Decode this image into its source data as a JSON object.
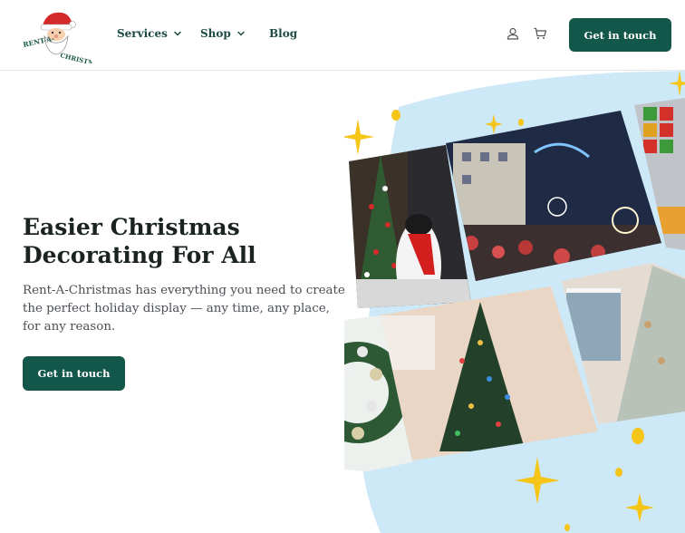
{
  "header": {
    "logo_text": "RENT-A-CHRISTMAS",
    "nav": [
      {
        "label": "Services",
        "has_dropdown": true
      },
      {
        "label": "Shop",
        "has_dropdown": true
      },
      {
        "label": "Blog",
        "has_dropdown": false
      }
    ],
    "icons": [
      "user-icon",
      "cart-icon"
    ],
    "cta_label": "Get in touch"
  },
  "hero": {
    "title": "Easier Christmas Decorating For All",
    "subtitle": "Rent-A-Christmas has everything you need to create the perfect holiday display — any time, any place, for any reason.",
    "cta_label": "Get in touch"
  },
  "colors": {
    "brand_green": "#12574a",
    "nav_text": "#1d4a42",
    "blob_blue": "#cde8f7",
    "star_gold": "#f5c518",
    "santa_red": "#d42a2a"
  }
}
